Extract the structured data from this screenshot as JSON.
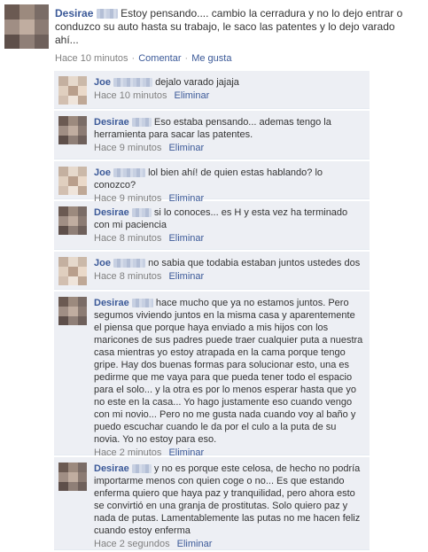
{
  "post": {
    "author": "Desirae",
    "text": "Estoy pensando.... cambio la cerradura y no lo dejo entrar o conduzco su auto hasta su trabajo, le saco las patentes y lo dejo varado ahí...",
    "time": "Hace 10 minutos",
    "comment_label": "Comentar",
    "like_label": "Me gusta"
  },
  "comments": [
    {
      "author": "Joe",
      "text": "dejalo varado jajaja",
      "time": "Hace 10 minutos",
      "delete_label": "Eliminar"
    },
    {
      "author": "Desirae",
      "text": "Eso estaba pensando... ademas tengo la herramienta para sacar las patentes.",
      "time": "Hace 9 minutos",
      "delete_label": "Eliminar"
    },
    {
      "author": "Joe",
      "text": "lol bien ahí! de quien estas hablando? lo conozco?",
      "time": "Hace 9 minutos",
      "delete_label": "Eliminar"
    },
    {
      "author": "Desirae",
      "text": "si lo conoces... es H y esta vez ha terminado con mi paciencia",
      "time": "Hace 8 minutos",
      "delete_label": "Eliminar"
    },
    {
      "author": "Joe",
      "text": "no sabia que todabia estaban juntos ustedes dos",
      "time": "Hace 8 minutos",
      "delete_label": "Eliminar"
    },
    {
      "author": "Desirae",
      "text": "hace mucho que ya no estamos juntos. Pero segumos viviendo juntos en la misma casa y aparentemente el piensa que porque haya enviado a mis hijos con los maricones de sus padres puede traer cualquier puta a nuestra casa mientras yo estoy atrapada en la cama porque tengo gripe. Hay dos buenas formas para solucionar esto, una es pedirme que me vaya para que pueda tener todo el espacio para el solo... y la otra es por lo menos esperar hasta que yo no este en la casa... Yo hago justamente eso cuando vengo con mi novio... Pero no me gusta nada cuando voy al baño y puedo escuchar cuando le da por el culo a la puta de su novia. Yo no estoy para eso.",
      "time": "Hace 2 minutos",
      "delete_label": "Eliminar"
    },
    {
      "author": "Desirae",
      "text": "y no es porque este celosa, de hecho no podría importarme menos con quien coge o no... Es que estando enferma quiero que haya paz y tranquilidad, pero ahora esto se convirtió en una granja de prostitutas. Solo quiero paz y nada de putas. Lamentablemente las putas no me hacen feliz cuando estoy enferma",
      "time": "Hace 2 segundos",
      "delete_label": "Eliminar"
    }
  ]
}
